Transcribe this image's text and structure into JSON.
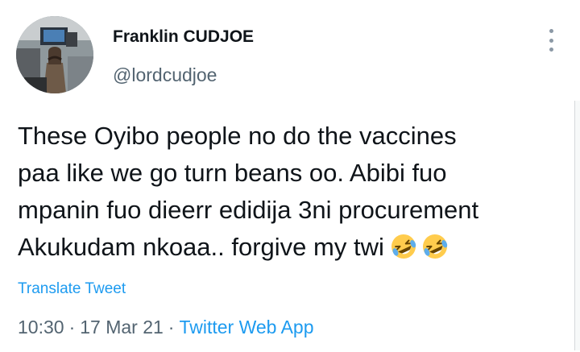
{
  "author": {
    "display_name": "Franklin CUDJOE",
    "handle": "@lordcudjoe"
  },
  "tweet": {
    "lines": [
      "These Oyibo people no do the vaccines",
      "paa like we go turn beans oo. Abibi fuo",
      "mpanin fuo dieerr edidija 3ni procurement",
      "Akukudam nkoaa.. forgive my twi"
    ],
    "emojis": [
      "rolling-on-floor-laughing",
      "rolling-on-floor-laughing"
    ]
  },
  "translate_label": "Translate Tweet",
  "meta": {
    "time": "10:30",
    "separator": "·",
    "date": "17 Mar 21",
    "source": "Twitter Web App"
  },
  "colors": {
    "link": "#1d9bf0",
    "secondary_text": "#536471",
    "primary_text": "#0f1419"
  }
}
